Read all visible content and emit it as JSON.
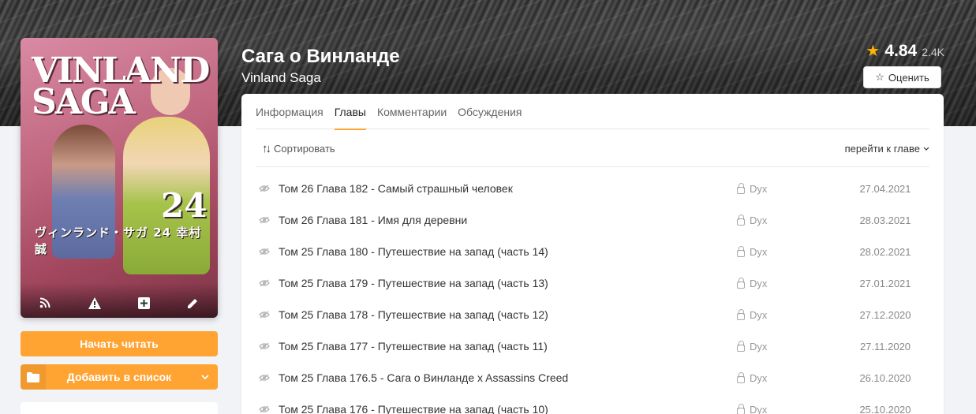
{
  "manga": {
    "title": "Сага о Винланде",
    "original_title": "Vinland Saga",
    "rating": "4.84",
    "rating_count": "2.4K",
    "rate_label": "Оценить"
  },
  "cover": {
    "logo_line1": "VINLAND",
    "logo_line2": "SAGA",
    "volume": "24",
    "jp_text": "ヴィンランド・サガ 24 幸村 誠",
    "icons": [
      "rss-icon",
      "warning-icon",
      "plus-icon",
      "edit-icon"
    ]
  },
  "actions": {
    "start_reading": "Начать читать",
    "add_to_list": "Добавить в список"
  },
  "tabs": [
    {
      "label": "Информация",
      "active": false
    },
    {
      "label": "Главы",
      "active": true
    },
    {
      "label": "Комментарии",
      "active": false
    },
    {
      "label": "Обсуждения",
      "active": false
    }
  ],
  "toolbar": {
    "sort_label": "Сортировать",
    "goto_label": "перейти к главе"
  },
  "chapters": [
    {
      "name": "Том 26 Глава 182 - Самый страшный человек",
      "translator": "Dyx",
      "date": "27.04.2021"
    },
    {
      "name": "Том 26 Глава 181 - Имя для деревни",
      "translator": "Dyx",
      "date": "28.03.2021"
    },
    {
      "name": "Том 25 Глава 180 - Путешествие на запад (часть 14)",
      "translator": "Dyx",
      "date": "28.02.2021"
    },
    {
      "name": "Том 25 Глава 179 - Путешествие на запад (часть 13)",
      "translator": "Dyx",
      "date": "27.01.2021"
    },
    {
      "name": "Том 25 Глава 178 - Путешествие на запад (часть 12)",
      "translator": "Dyx",
      "date": "27.12.2020"
    },
    {
      "name": "Том 25 Глава 177 - Путешествие на запад (часть 11)",
      "translator": "Dyx",
      "date": "27.11.2020"
    },
    {
      "name": "Том 25 Глава 176.5 - Сага о Винланде x Assassins Creed",
      "translator": "Dyx",
      "date": "26.10.2020"
    },
    {
      "name": "Том 25 Глава 176 - Путешествие на запад (часть 10)",
      "translator": "Dyx",
      "date": "25.10.2020"
    }
  ],
  "colors": {
    "accent": "#ffa332",
    "star": "#ffb400",
    "background": "#f2f3f7"
  }
}
